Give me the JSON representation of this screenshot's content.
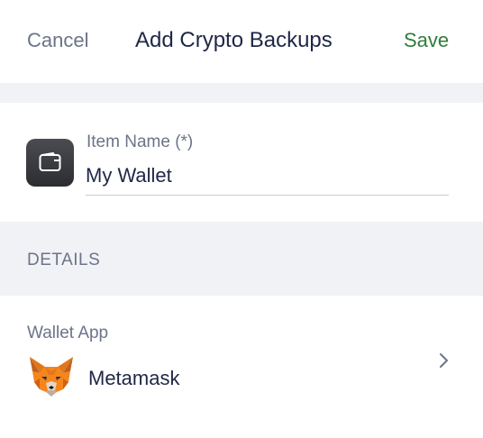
{
  "header": {
    "cancel_label": "Cancel",
    "title": "Add Crypto Backups",
    "save_label": "Save"
  },
  "item": {
    "icon": "wallet-icon",
    "field_label": "Item Name (*)",
    "field_value": "My Wallet"
  },
  "details": {
    "heading": "DETAILS"
  },
  "wallet_app": {
    "label": "Wallet App",
    "value": "Metamask",
    "logo": "metamask-fox-logo",
    "chevron": "chevron-right-icon"
  },
  "colors": {
    "cancel": "#6b7488",
    "title": "#1f2747",
    "save": "#2f7d3a",
    "band": "#f1f2f6"
  }
}
